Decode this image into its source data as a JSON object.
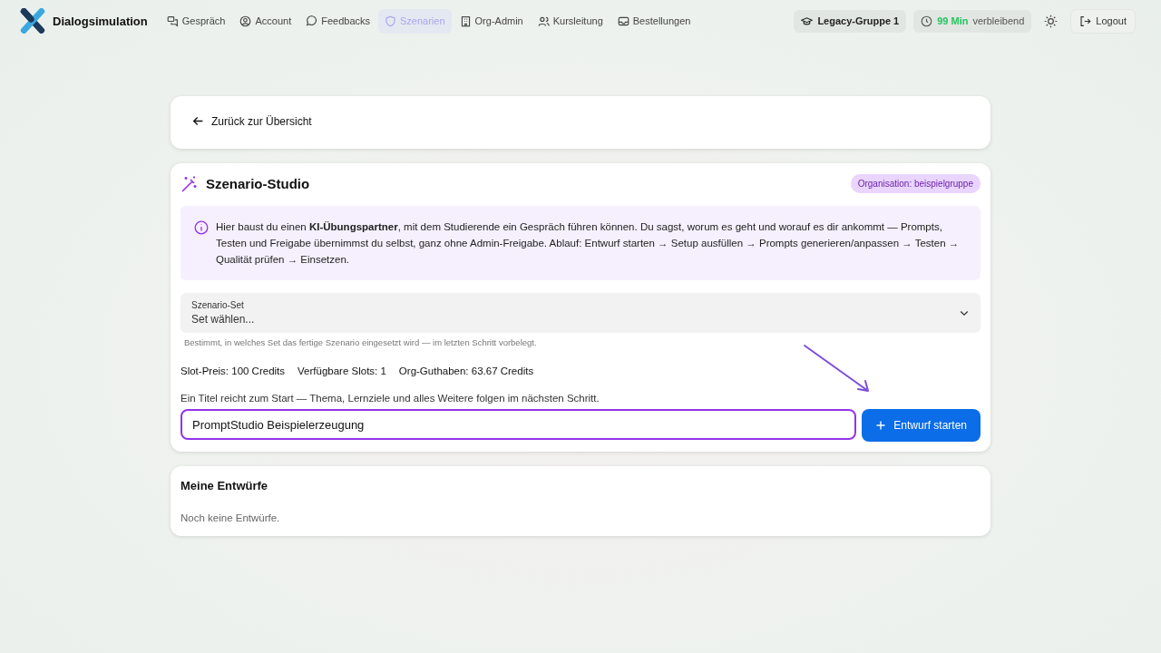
{
  "brand": {
    "name": "Dialogsimulation"
  },
  "nav": [
    {
      "label": "Gespräch",
      "selected": false
    },
    {
      "label": "Account",
      "selected": false
    },
    {
      "label": "Feedbacks",
      "selected": false
    },
    {
      "label": "Szenarien",
      "selected": true
    },
    {
      "label": "Org-Admin",
      "selected": false
    },
    {
      "label": "Kursleitung",
      "selected": false
    },
    {
      "label": "Bestellungen",
      "selected": false
    }
  ],
  "group": "Legacy-Gruppe 1",
  "time": {
    "value": "99 Min",
    "suffix": "verbleibend"
  },
  "logout": "Logout",
  "back": "Zurück zur Übersicht",
  "studio": {
    "title": "Szenario-Studio",
    "org_badge": "Organisation: beispielgruppe",
    "info": "Hier baust du einen **KI-Übungspartner**, mit dem Studierende ein Gespräch führen können. Du sagst, worum es geht und worauf es dir ankommt — Prompts, Testen und Freigabe übernimmst du selbst, ganz ohne Admin-Freigabe. Ablauf: Entwurf starten → Setup ausfüllen → Prompts generieren/anpassen → Testen → Qualität prüfen → Einsetzen.",
    "set_label": "Szenario-Set",
    "set_value": "Set wählen...",
    "set_hint": "Bestimmt, in welches Set das fertige Szenario eingesetzt wird — im letzten Schritt vorbelegt.",
    "stats": [
      "Slot-Preis: 100 Credits",
      "Verfügbare Slots: 1",
      "Org-Guthaben: 63.67 Credits"
    ],
    "title_hint": "Ein Titel reicht zum Start — Thema, Lernziele und alles Weitere folgen im nächsten Schritt.",
    "title_value": "PromptStudio Beispielerzeugung",
    "start_button": "Entwurf starten"
  },
  "drafts": {
    "title": "Meine Entwürfe",
    "empty": "Noch keine Entwürfe."
  }
}
